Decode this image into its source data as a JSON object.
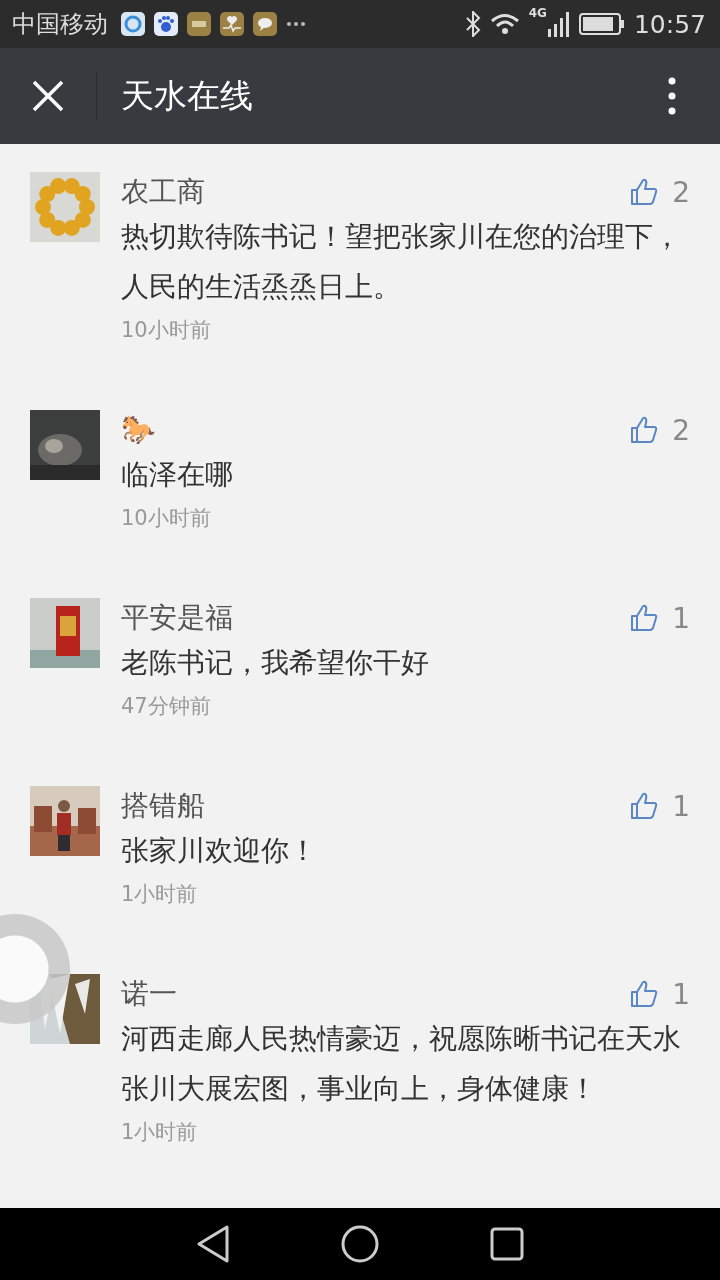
{
  "status_bar": {
    "carrier": "中国移动",
    "network": "4G",
    "time": "10:57"
  },
  "app_bar": {
    "title": "天水在线"
  },
  "comments": [
    {
      "name": "农工商",
      "text": "热切欺待陈书记！望把张家川在您的治理下，人民的生活烝烝日上。",
      "time": "10小时前",
      "likes": "2"
    },
    {
      "name": "🐎",
      "text": "临泽在哪",
      "time": "10小时前",
      "likes": "2"
    },
    {
      "name": "平安是福",
      "text": "老陈书记，我希望你干好",
      "time": "47分钟前",
      "likes": "1"
    },
    {
      "name": "搭错船",
      "text": "张家川欢迎你！",
      "time": "1小时前",
      "likes": "1"
    },
    {
      "name": "诺一",
      "text": "河西走廊人民热情豪迈，祝愿陈晰书记在天水张川大展宏图，事业向上，身体健康！",
      "time": "1小时前",
      "likes": "1"
    }
  ]
}
